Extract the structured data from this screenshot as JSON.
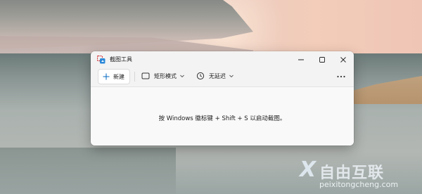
{
  "window": {
    "title": "截图工具",
    "controls": {
      "minimize_icon": "minimize-icon",
      "maximize_icon": "maximize-icon",
      "close_icon": "close-icon"
    }
  },
  "toolbar": {
    "new_label": "新建",
    "mode_label": "矩形模式",
    "delay_label": "无延迟",
    "more_icon": "more-icon"
  },
  "content": {
    "hint": "按 Windows 徽标键 + Shift + S 以启动截图。"
  },
  "watermark": {
    "mark": "X",
    "title": "自由互联",
    "url": "peixitongcheng.com"
  },
  "colors": {
    "accent": "#0067c0",
    "window_bg": "#f9f9f9",
    "titlebar_bg": "#f3f3f3"
  }
}
